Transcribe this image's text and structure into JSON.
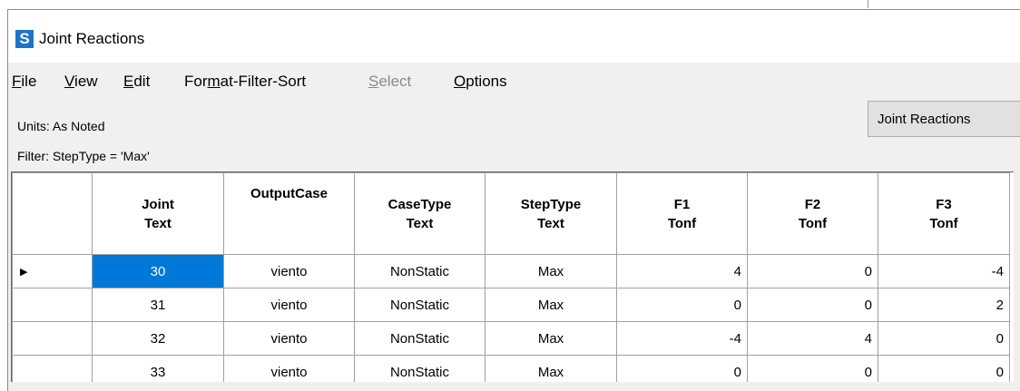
{
  "window": {
    "icon_letter": "S",
    "title": "Joint Reactions"
  },
  "menu": {
    "items": [
      {
        "mnemonic": "F",
        "rest": "ile",
        "pre": ""
      },
      {
        "mnemonic": "V",
        "rest": "iew",
        "pre": ""
      },
      {
        "mnemonic": "E",
        "rest": "dit",
        "pre": ""
      },
      {
        "mnemonic": "m",
        "rest": "at-Filter-Sort",
        "pre": "For"
      },
      {
        "mnemonic": "S",
        "rest": "elect",
        "pre": ""
      },
      {
        "mnemonic": "O",
        "rest": "ptions",
        "pre": ""
      }
    ]
  },
  "info": {
    "units": "Units:  As Noted",
    "filter": "Filter:  StepType = 'Max'",
    "table_button": "Joint Reactions"
  },
  "table": {
    "columns": [
      {
        "line1": "Joint",
        "line2": "Text"
      },
      {
        "line1": "OutputCase",
        "line2": ""
      },
      {
        "line1": "CaseType",
        "line2": "Text"
      },
      {
        "line1": "StepType",
        "line2": "Text"
      },
      {
        "line1": "F1",
        "line2": "Tonf"
      },
      {
        "line1": "F2",
        "line2": "Tonf"
      },
      {
        "line1": "F3",
        "line2": "Tonf"
      }
    ],
    "current_row_marker": "▶",
    "rows": [
      [
        "30",
        "viento",
        "NonStatic",
        "Max",
        "4",
        "0",
        "-4"
      ],
      [
        "31",
        "viento",
        "NonStatic",
        "Max",
        "0",
        "0",
        "2"
      ],
      [
        "32",
        "viento",
        "NonStatic",
        "Max",
        "-4",
        "4",
        "0"
      ],
      [
        "33",
        "viento",
        "NonStatic",
        "Max",
        "0",
        "0",
        "0"
      ]
    ]
  }
}
